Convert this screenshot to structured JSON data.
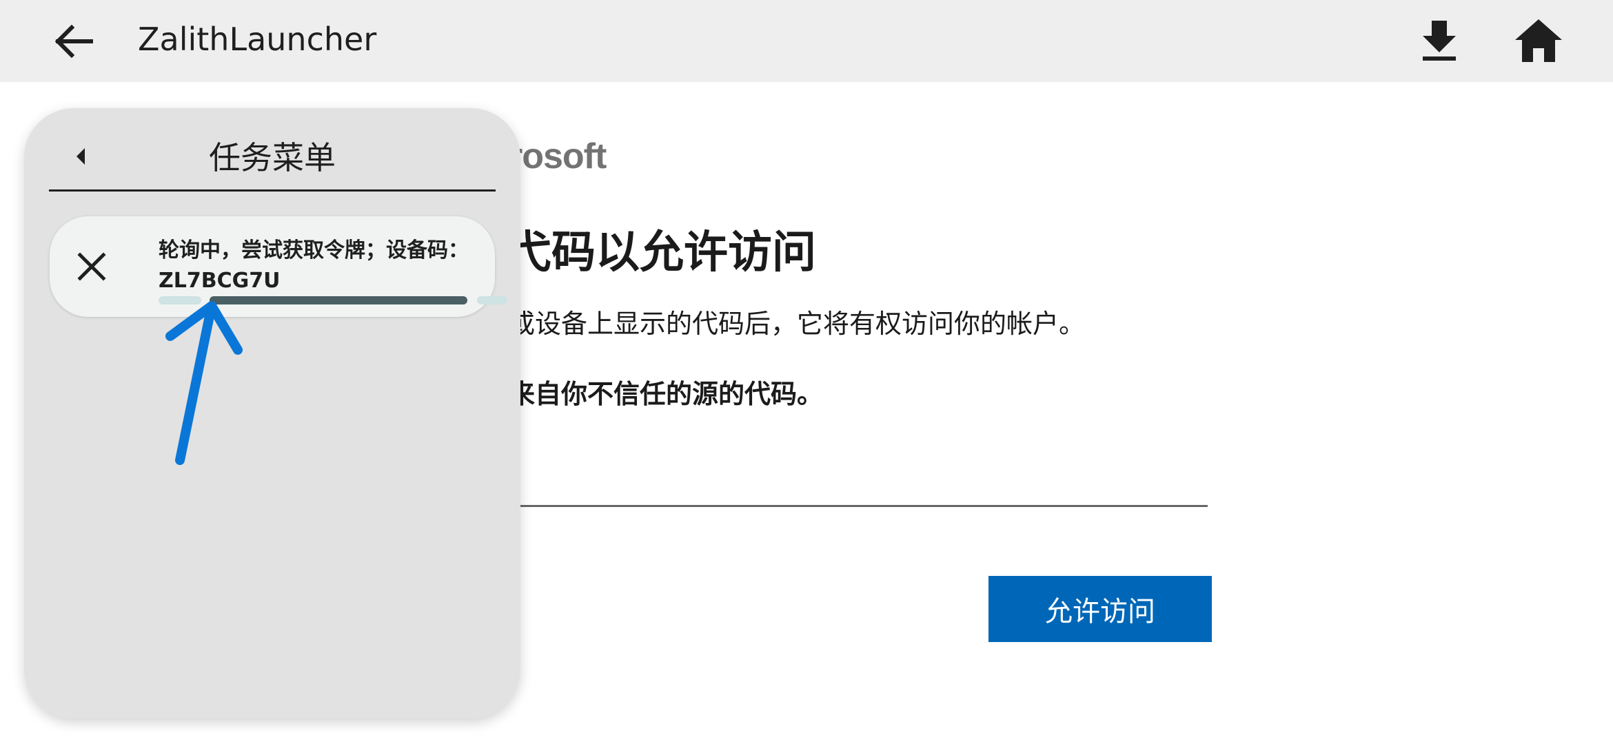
{
  "app_bar": {
    "title": "ZalithLauncher",
    "back_icon": "arrow-left-icon",
    "download_icon": "download-icon",
    "home_icon": "home-icon"
  },
  "web_page": {
    "logo_text": "rosoft",
    "heading": "弋码以允许访问",
    "description": "或设备上显示的代码后，它将有权访问你的帐户。",
    "warning": "来自你不信任的源的代码。",
    "code_input_value": "",
    "allow_button_label": "允许访问",
    "accent_color": "#0067b8"
  },
  "task_menu": {
    "title": "任务菜单",
    "back_icon": "caret-left-icon",
    "tasks": [
      {
        "line1": "轮询中，尝试获取令牌；设备码：",
        "line2": "ZL7BCG7U",
        "cancel_icon": "close-icon",
        "progress_state": "indeterminate"
      }
    ]
  },
  "annotation": {
    "arrow_color": "#0a77d8",
    "icon": "arrow-up-annotation"
  }
}
